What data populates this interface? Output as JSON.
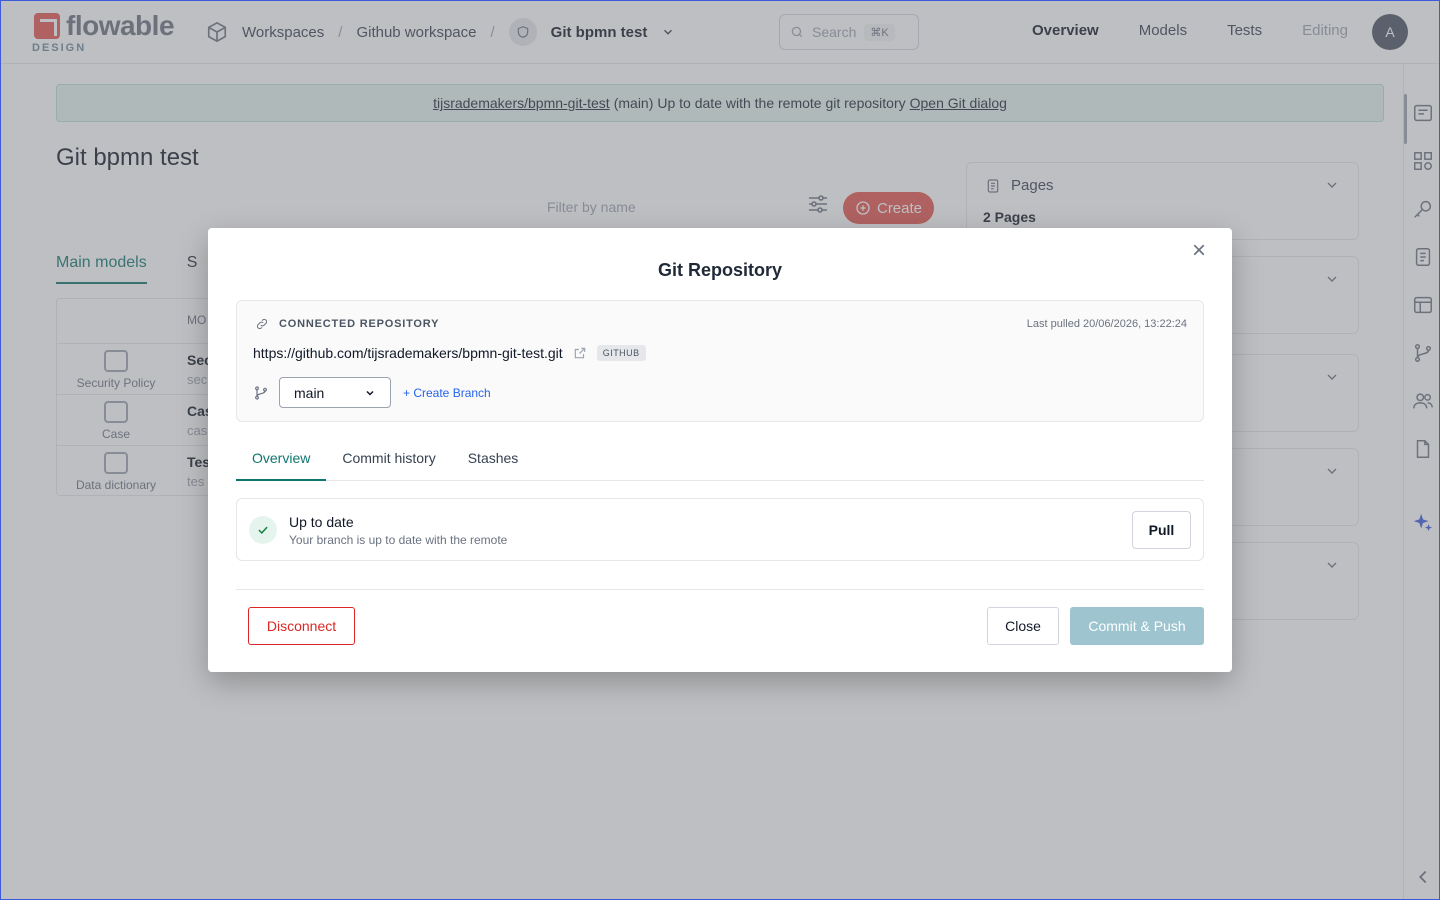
{
  "app": {
    "logo_text": "flowable",
    "logo_sub": "DESIGN"
  },
  "breadcrumbs": {
    "workspaces": "Workspaces",
    "workspace": "Github workspace",
    "app": "Git bpmn test",
    "separator": "/"
  },
  "search": {
    "placeholder": "Search",
    "shortcut": "⌘K"
  },
  "topnav": {
    "overview": "Overview",
    "models": "Models",
    "tests": "Tests",
    "editing": "Editing"
  },
  "user": {
    "avatar_initial": "A"
  },
  "banner": {
    "repo_link": "tijsrademakers/bpmn-git-test",
    "branch": "(main)",
    "message": "Up to date with the remote git repository",
    "open_link": "Open Git dialog"
  },
  "page": {
    "title": "Git bpmn test",
    "filter_placeholder": "Filter by name",
    "create_label": "Create"
  },
  "bg_tabs": {
    "main_models": "Main models",
    "second": "S"
  },
  "bg_table": {
    "header_fragment": "MO",
    "rows": [
      {
        "type": "Security Policy",
        "name": "Sec",
        "sub": "sec"
      },
      {
        "type": "Case",
        "name": "Cas",
        "sub": "cas"
      },
      {
        "type": "Data dictionary",
        "name": "Tes",
        "sub": "tes"
      }
    ]
  },
  "side_panel": {
    "pages_title": "Pages",
    "pages_value": "2 Pages"
  },
  "modal": {
    "title": "Git Repository",
    "close_icon": "×",
    "repo": {
      "heading": "CONNECTED REPOSITORY",
      "last_pulled": "Last pulled 20/06/2026, 13:22:24",
      "url": "https://github.com/tijsrademakers/bpmn-git-test.git",
      "provider_badge": "GITHUB",
      "branch_selected": "main",
      "create_branch": "+ Create Branch"
    },
    "tabs": [
      "Overview",
      "Commit history",
      "Stashes"
    ],
    "status": {
      "title": "Up to date",
      "subtitle": "Your branch is up to date with the remote",
      "pull_label": "Pull"
    },
    "footer": {
      "disconnect": "Disconnect",
      "close": "Close",
      "commit_push": "Commit & Push"
    }
  },
  "colors": {
    "accent_teal": "#0f766e",
    "brand_red": "#e4574f",
    "danger": "#dc2626",
    "disabled_primary": "#9ec5cf",
    "banner_bg": "#e6f4ee"
  }
}
